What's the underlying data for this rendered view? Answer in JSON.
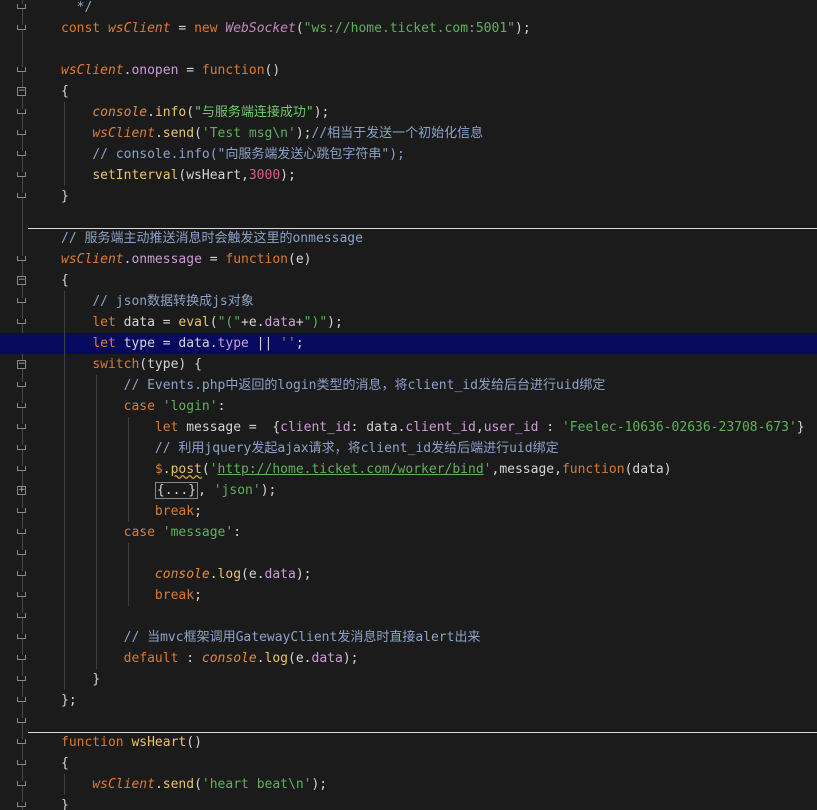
{
  "editor": {
    "lines": [
      [
        {
          "t": "  */",
          "c": "c"
        }
      ],
      [
        {
          "t": "const ",
          "c": "k"
        },
        {
          "t": "wsClient",
          "c": "v"
        },
        {
          "t": " = ",
          "c": "p"
        },
        {
          "t": "new ",
          "c": "k"
        },
        {
          "t": "WebSocket",
          "c": "cls"
        },
        {
          "t": "(",
          "c": "p"
        },
        {
          "t": "\"ws://home.ticket.com:5001\"",
          "c": "s"
        },
        {
          "t": ");",
          "c": "p"
        }
      ],
      [],
      [
        {
          "t": "wsClient",
          "c": "v"
        },
        {
          "t": ".",
          "c": "p"
        },
        {
          "t": "onopen",
          "c": "pr"
        },
        {
          "t": " = ",
          "c": "p"
        },
        {
          "t": "function",
          "c": "k"
        },
        {
          "t": "()",
          "c": "p"
        }
      ],
      [
        {
          "t": "{",
          "c": "p"
        }
      ],
      [
        {
          "t": "    "
        },
        {
          "t": "console",
          "c": "vc"
        },
        {
          "t": ".",
          "c": "p"
        },
        {
          "t": "info",
          "c": "fn"
        },
        {
          "t": "(",
          "c": "p"
        },
        {
          "t": "\"与服务端连接成功\"",
          "c": "st"
        },
        {
          "t": ");",
          "c": "p"
        }
      ],
      [
        {
          "t": "    "
        },
        {
          "t": "wsClient",
          "c": "v"
        },
        {
          "t": ".",
          "c": "p"
        },
        {
          "t": "send",
          "c": "fn"
        },
        {
          "t": "(",
          "c": "p"
        },
        {
          "t": "'Test msg\\n'",
          "c": "s"
        },
        {
          "t": ");",
          "c": "p"
        },
        {
          "t": "//相当于发送一个初始化信息",
          "c": "c"
        }
      ],
      [
        {
          "t": "    "
        },
        {
          "t": "// console.info(\"向服务端发送心跳包字符串\");",
          "c": "c"
        }
      ],
      [
        {
          "t": "    "
        },
        {
          "t": "setInterval",
          "c": "fn"
        },
        {
          "t": "(",
          "c": "p"
        },
        {
          "t": "wsHeart",
          "c": "p"
        },
        {
          "t": ",",
          "c": "p"
        },
        {
          "t": "3000",
          "c": "n"
        },
        {
          "t": ");",
          "c": "p"
        }
      ],
      [
        {
          "t": "}",
          "c": "p"
        }
      ],
      [],
      [
        {
          "t": "// 服务端主动推送消息时会触发这里的onmessage",
          "c": "c"
        }
      ],
      [
        {
          "t": "wsClient",
          "c": "v"
        },
        {
          "t": ".",
          "c": "p"
        },
        {
          "t": "onmessage",
          "c": "pr"
        },
        {
          "t": " = ",
          "c": "p"
        },
        {
          "t": "function",
          "c": "k"
        },
        {
          "t": "(e)",
          "c": "p"
        }
      ],
      [
        {
          "t": "{",
          "c": "p"
        }
      ],
      [
        {
          "t": "    "
        },
        {
          "t": "// json数据转换成js对象",
          "c": "c"
        }
      ],
      [
        {
          "t": "    "
        },
        {
          "t": "let ",
          "c": "k"
        },
        {
          "t": "data = ",
          "c": "p"
        },
        {
          "t": "eval",
          "c": "fn"
        },
        {
          "t": "(",
          "c": "p"
        },
        {
          "t": "\"(\"",
          "c": "s"
        },
        {
          "t": "+",
          "c": "p"
        },
        {
          "t": "e",
          "c": "p"
        },
        {
          "t": ".",
          "c": "p"
        },
        {
          "t": "data",
          "c": "pr"
        },
        {
          "t": "+",
          "c": "p"
        },
        {
          "t": "\")\"",
          "c": "s"
        },
        {
          "t": ");",
          "c": "p"
        }
      ],
      [
        {
          "t": "    "
        },
        {
          "t": "let ",
          "c": "k"
        },
        {
          "t": "type = data",
          "c": "p"
        },
        {
          "t": ".",
          "c": "p"
        },
        {
          "t": "type",
          "c": "pr"
        },
        {
          "t": " || ",
          "c": "p"
        },
        {
          "t": "''",
          "c": "s"
        },
        {
          "t": ";",
          "c": "p"
        }
      ],
      [
        {
          "t": "    "
        },
        {
          "t": "switch",
          "c": "k"
        },
        {
          "t": "(type) {",
          "c": "p"
        }
      ],
      [
        {
          "t": "        "
        },
        {
          "t": "// Events.php中返回的login类型的消息，将client_id发给后台进行uid绑定",
          "c": "c"
        }
      ],
      [
        {
          "t": "        "
        },
        {
          "t": "case ",
          "c": "k"
        },
        {
          "t": "'login'",
          "c": "s"
        },
        {
          "t": ":",
          "c": "p"
        }
      ],
      [
        {
          "t": "            "
        },
        {
          "t": "let ",
          "c": "k"
        },
        {
          "t": "message =  {",
          "c": "p"
        },
        {
          "t": "client_id",
          "c": "pr"
        },
        {
          "t": ": data",
          "c": "p"
        },
        {
          "t": ".",
          "c": "p"
        },
        {
          "t": "client_id",
          "c": "pr"
        },
        {
          "t": ",",
          "c": "p"
        },
        {
          "t": "user_id",
          "c": "pr"
        },
        {
          "t": " : ",
          "c": "p"
        },
        {
          "t": "'Feelec-10636-02636-23708-673'",
          "c": "s"
        },
        {
          "t": "}",
          "c": "p"
        }
      ],
      [
        {
          "t": "            "
        },
        {
          "t": "// 利用jquery发起ajax请求，将client_id发给后端进行uid绑定",
          "c": "c"
        }
      ],
      [
        {
          "t": "            "
        },
        {
          "t": "$",
          "c": "k"
        },
        {
          "t": ".",
          "c": "p"
        },
        {
          "t": "post",
          "c": "fn",
          "x": "squig"
        },
        {
          "t": "(",
          "c": "p"
        },
        {
          "t": "'",
          "c": "s"
        },
        {
          "t": "http://home.ticket.com/worker/bind",
          "c": "u"
        },
        {
          "t": "'",
          "c": "s"
        },
        {
          "t": ",",
          "c": "p"
        },
        {
          "t": "message",
          "c": "p"
        },
        {
          "t": ",",
          "c": "p"
        },
        {
          "t": "function",
          "c": "k"
        },
        {
          "t": "(data)",
          "c": "p"
        }
      ],
      [
        {
          "t": "            "
        },
        {
          "t": "{...}",
          "c": "p",
          "x": "box"
        },
        {
          "t": ", ",
          "c": "p"
        },
        {
          "t": "'json'",
          "c": "s"
        },
        {
          "t": ");",
          "c": "p"
        }
      ],
      [
        {
          "t": "            "
        },
        {
          "t": "break",
          "c": "k"
        },
        {
          "t": ";",
          "c": "p"
        }
      ],
      [
        {
          "t": "        "
        },
        {
          "t": "case ",
          "c": "k"
        },
        {
          "t": "'message'",
          "c": "s"
        },
        {
          "t": ":",
          "c": "p"
        }
      ],
      [],
      [
        {
          "t": "            "
        },
        {
          "t": "console",
          "c": "vc"
        },
        {
          "t": ".",
          "c": "p"
        },
        {
          "t": "log",
          "c": "fn"
        },
        {
          "t": "(e",
          "c": "p"
        },
        {
          "t": ".",
          "c": "p"
        },
        {
          "t": "data",
          "c": "pr"
        },
        {
          "t": ");",
          "c": "p"
        }
      ],
      [
        {
          "t": "            "
        },
        {
          "t": "break",
          "c": "k"
        },
        {
          "t": ";",
          "c": "p"
        }
      ],
      [],
      [
        {
          "t": "        "
        },
        {
          "t": "// 当mvc框架调用GatewayClient发消息时直接alert出来",
          "c": "c"
        }
      ],
      [
        {
          "t": "        "
        },
        {
          "t": "default ",
          "c": "k"
        },
        {
          "t": ": ",
          "c": "p"
        },
        {
          "t": "console",
          "c": "vc"
        },
        {
          "t": ".",
          "c": "p"
        },
        {
          "t": "log",
          "c": "fn"
        },
        {
          "t": "(e",
          "c": "p"
        },
        {
          "t": ".",
          "c": "p"
        },
        {
          "t": "data",
          "c": "pr"
        },
        {
          "t": ");",
          "c": "p"
        }
      ],
      [
        {
          "t": "    "
        },
        {
          "t": "}",
          "c": "p"
        }
      ],
      [
        {
          "t": "};",
          "c": "p"
        }
      ],
      [],
      [
        {
          "t": "function ",
          "c": "k"
        },
        {
          "t": "wsHeart",
          "c": "fn"
        },
        {
          "t": "()",
          "c": "p"
        }
      ],
      [
        {
          "t": "{",
          "c": "p"
        }
      ],
      [
        {
          "t": "    "
        },
        {
          "t": "wsClient",
          "c": "v"
        },
        {
          "t": ".",
          "c": "p"
        },
        {
          "t": "send",
          "c": "fn"
        },
        {
          "t": "(",
          "c": "p"
        },
        {
          "t": "'heart beat\\n'",
          "c": "s"
        },
        {
          "t": ");",
          "c": "p"
        }
      ],
      [
        {
          "t": "}",
          "c": "p"
        }
      ]
    ]
  }
}
